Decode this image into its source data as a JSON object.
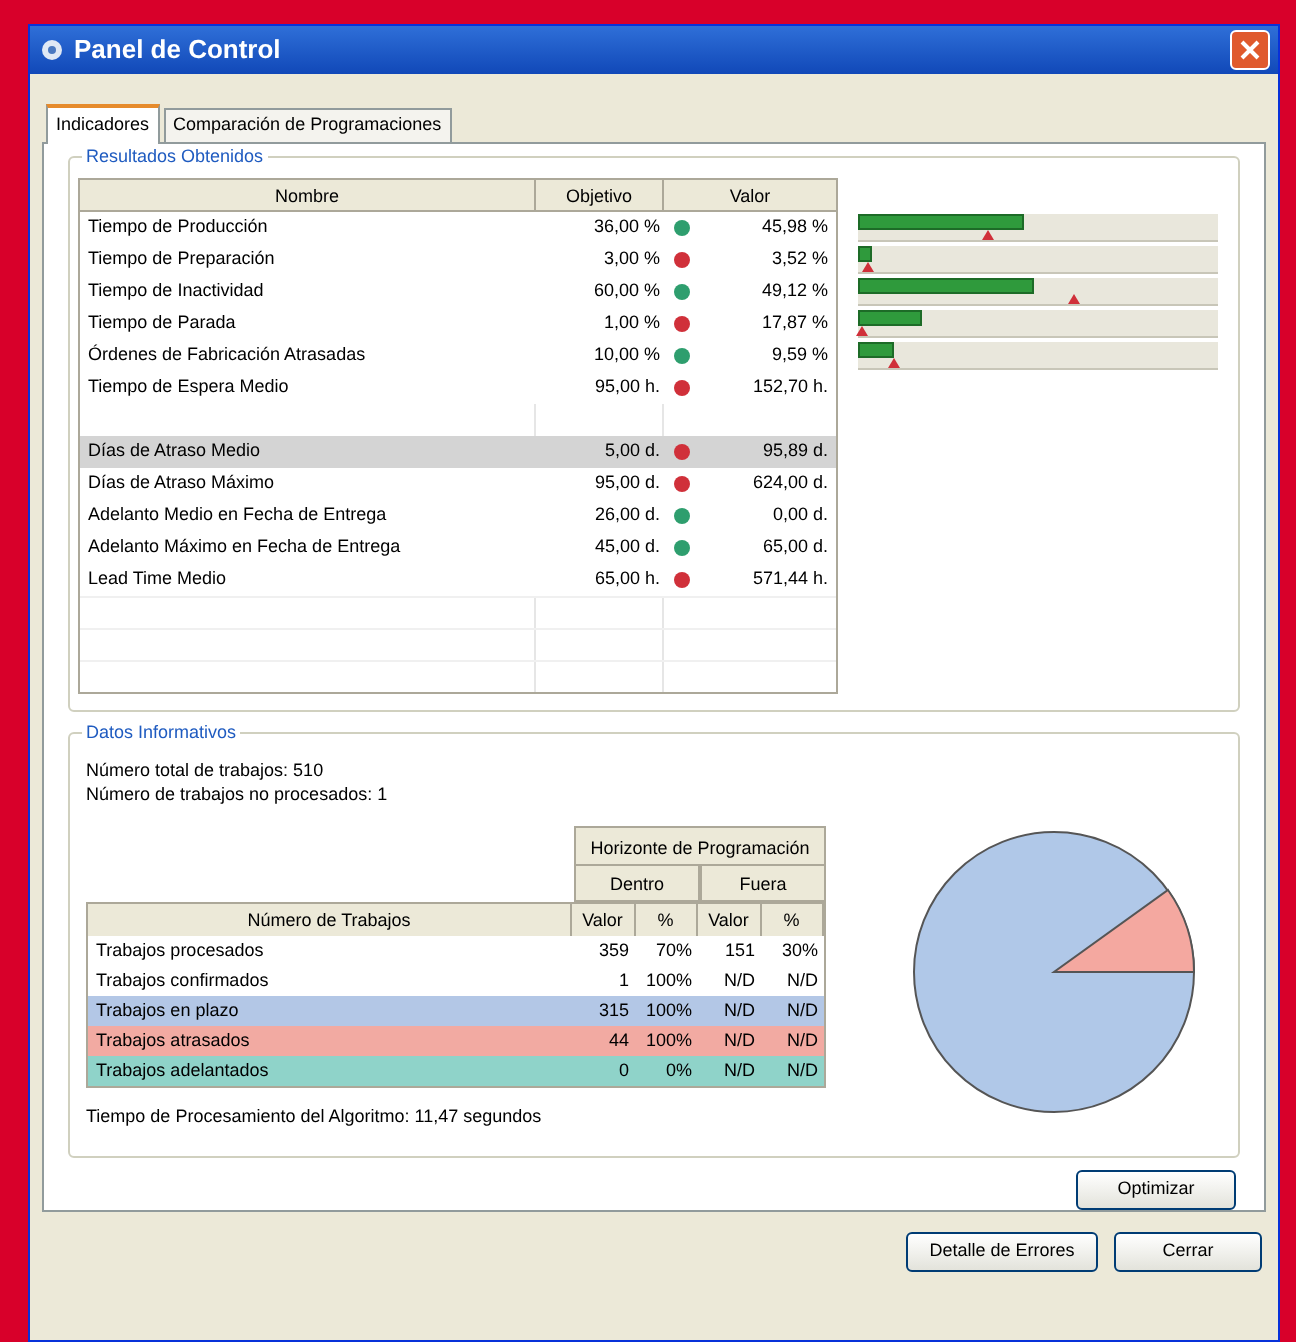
{
  "window": {
    "title": "Panel de Control"
  },
  "tabs": [
    {
      "label": "Indicadores",
      "selected": true
    },
    {
      "label": "Comparación de Programaciones",
      "selected": false
    }
  ],
  "results": {
    "title": "Resultados Obtenidos",
    "columns": [
      "Nombre",
      "Objetivo",
      "Valor"
    ],
    "rows": [
      {
        "name": "Tiempo de Producción",
        "target": "36,00 %",
        "color": "#2e9e6e",
        "value": "45,98 %",
        "bar": {
          "level": 0.46
        }
      },
      {
        "name": "Tiempo de Preparación",
        "target": "3,00 %",
        "color": "#d0303a",
        "value": "3,52 %",
        "bar": {
          "level": 0.04
        }
      },
      {
        "name": "Tiempo de Inactividad",
        "target": "60,00 %",
        "color": "#2e9e6e",
        "value": "49,12 %",
        "bar": {
          "level": 0.49
        }
      },
      {
        "name": "Tiempo de Parada",
        "target": "1,00 %",
        "color": "#d0303a",
        "value": "17,87 %",
        "bar": {
          "level": 0.18
        }
      },
      {
        "name": "Órdenes de Fabricación Atrasadas",
        "target": "10,00 %",
        "color": "#2e9e6e",
        "value": "9,59 %",
        "bar": {
          "level": 0.1
        }
      },
      {
        "name": "Tiempo de Espera Medio",
        "target": "95,00 h.",
        "color": "#d0303a",
        "value": "152,70 h."
      },
      {
        "kind": "blank"
      },
      {
        "name": "Días de Atraso Medio",
        "target": "5,00 d.",
        "color": "#d0303a",
        "value": "95,89 d.",
        "selected": true
      },
      {
        "name": "Días de Atraso Máximo",
        "target": "95,00 d.",
        "color": "#d0303a",
        "value": "624,00 d."
      },
      {
        "name": "Adelanto Medio en Fecha de Entrega",
        "target": "26,00 d.",
        "color": "#2e9e6e",
        "value": "0,00 d."
      },
      {
        "name": "Adelanto Máximo en Fecha de Entrega",
        "target": "45,00 d.",
        "color": "#2e9e6e",
        "value": "65,00 d."
      },
      {
        "name": "Lead Time Medio",
        "target": "65,00 h.",
        "color": "#d0303a",
        "value": "571,44 h."
      }
    ]
  },
  "info": {
    "title": "Datos Informativos",
    "lines": [
      "Número total de trabajos: 510",
      "Número de trabajos no procesados: 1"
    ],
    "table": {
      "group": "Horizonte de Programación",
      "subgroups": [
        "Dentro",
        "Fuera"
      ],
      "columns": [
        "Número de Trabajos",
        "Valor",
        "%",
        "Valor",
        "%"
      ],
      "rows": [
        {
          "cells": [
            "Trabajos procesados",
            "359",
            "70%",
            "151",
            "30%"
          ]
        },
        {
          "cells": [
            "Trabajos confirmados",
            "1",
            "100%",
            "N/D",
            "N/D"
          ]
        },
        {
          "cells": [
            "Trabajos en plazo",
            "315",
            "100%",
            "N/D",
            "N/D"
          ],
          "color": "#b3c7e6"
        },
        {
          "cells": [
            "Trabajos atrasados",
            "44",
            "100%",
            "N/D",
            "N/D"
          ],
          "color": "#f2aaa2"
        },
        {
          "cells": [
            "Trabajos adelantados",
            "0",
            "0%",
            "N/D",
            "N/D"
          ],
          "color": "#8fd3c9"
        }
      ]
    },
    "footer": "Tiempo de Procesamiento del Algoritmo: 11,47 segundos"
  },
  "optimize_button": "Optimizar",
  "buttons": [
    "Detalle de Errores",
    "Cerrar"
  ]
}
